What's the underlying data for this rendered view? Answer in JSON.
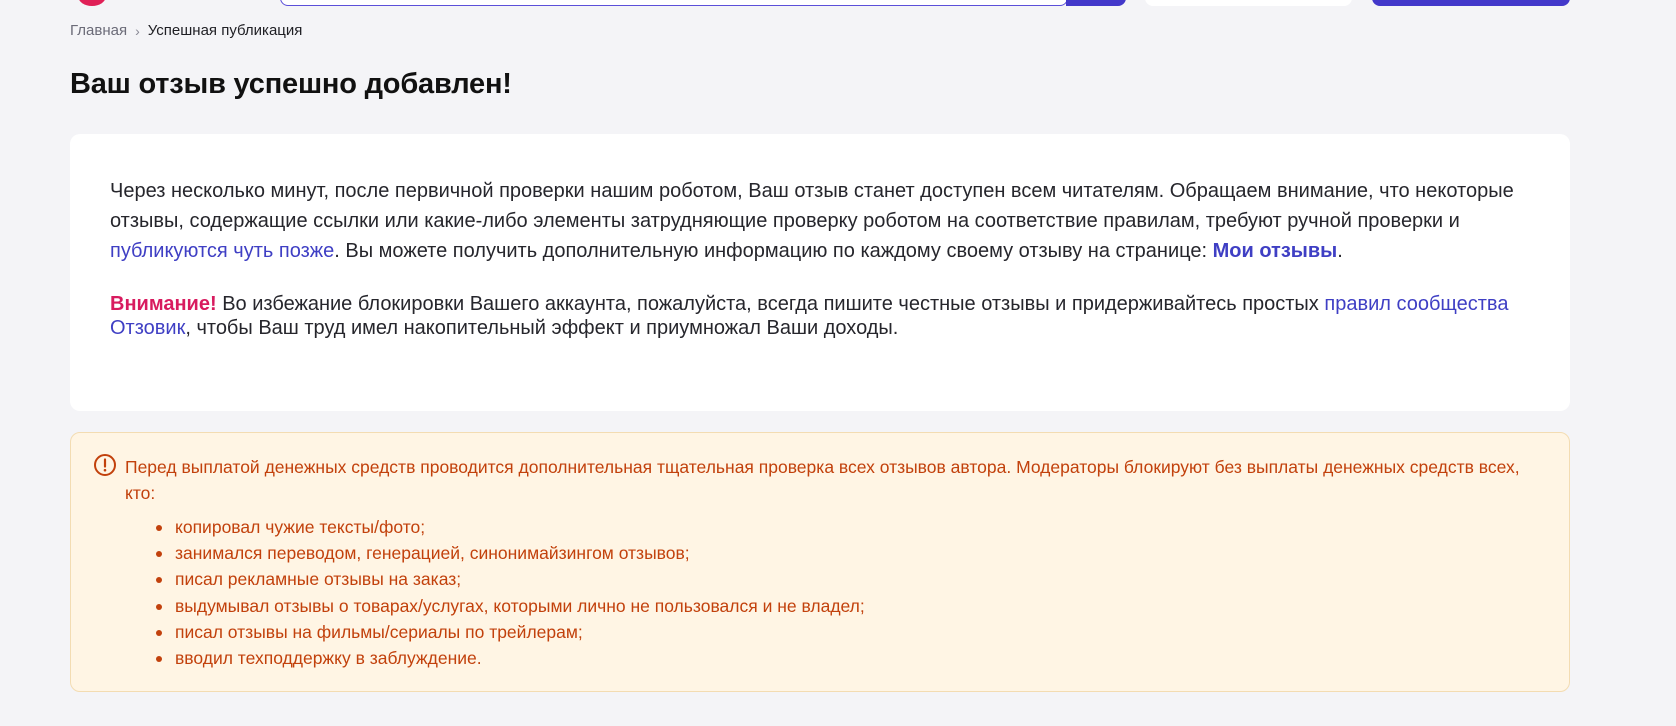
{
  "breadcrumb": {
    "home": "Главная",
    "separator": "›",
    "current": "Успешная публикация"
  },
  "page_title": "Ваш отзыв успешно добавлен!",
  "info_card": {
    "p1_text_a": "Через несколько минут, после первичной проверки нашим роботом, Ваш отзыв станет доступен всем читателям. Обращаем внимание, что некоторые отзывы, содержащие ссылки или какие-либо элементы затрудняющие проверку роботом на соответствие правилам, требуют ручной проверки и ",
    "p1_link": "публикуются чуть позже",
    "p1_text_b": ". Вы можете получить дополнительную информацию по каждому своему отзыву на странице: ",
    "my_reviews_link": "Мои отзывы",
    "p1_end": ".",
    "attention_label": "Внимание!",
    "p2_text_a": " Во избежание блокировки Вашего аккаунта, пожалуйста, всегда пишите честные отзывы и придерживайтесь простых ",
    "rules_link": "правил сообщества Отзовик",
    "p2_text_b": ", чтобы Ваш труд имел накопительный эффект и приумножал Ваши доходы."
  },
  "warning": {
    "icon": "alert-circle-icon",
    "intro": "Перед выплатой денежных средств проводится дополнительная тщательная проверка всех отзывов автора. Модераторы блокируют без выплаты денежных средств всех, кто:",
    "items": [
      "копировал чужие тексты/фото;",
      "занимался переводом, генерацией, синонимайзингом отзывов;",
      "писал рекламные отзывы на заказ;",
      "выдумывал отзывы о товарах/услугах, которыми лично не пользовался и не владел;",
      "писал отзывы на фильмы/сериалы по трейлерам;",
      "вводил техподдержку в заблуждение."
    ]
  },
  "colors": {
    "accent": "#4338ca",
    "link": "#3f3fc4",
    "attention": "#d81b5f",
    "warning_text": "#c2410c",
    "warning_bg": "#fff5e4",
    "page_bg": "#f4f4f7"
  }
}
